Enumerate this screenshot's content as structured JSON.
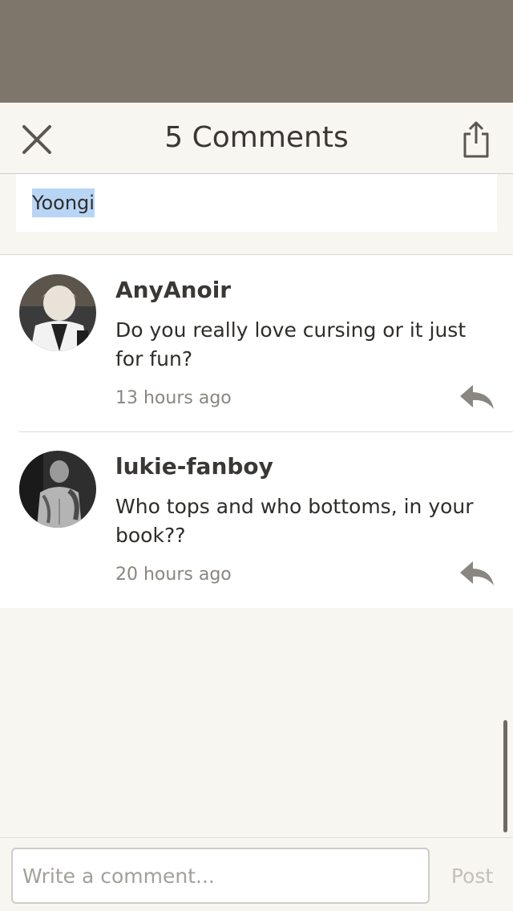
{
  "header": {
    "title": "5 Comments",
    "close_icon": "close-icon",
    "share_icon": "share-icon"
  },
  "quote": {
    "text": "Yoongi"
  },
  "comments": [
    {
      "author": "AnyAnoir",
      "text": "Do you really love cursing or it just for fun?",
      "time": "13 hours ago"
    },
    {
      "author": "lukie-fanboy",
      "text": "Who tops and who bottoms, in your book??",
      "time": "20 hours ago"
    }
  ],
  "composer": {
    "placeholder": "Write a comment...",
    "post_label": "Post"
  },
  "colors": {
    "backdrop": "#7e766a",
    "background": "#f7f6f1",
    "highlight": "#b9d5f5"
  }
}
